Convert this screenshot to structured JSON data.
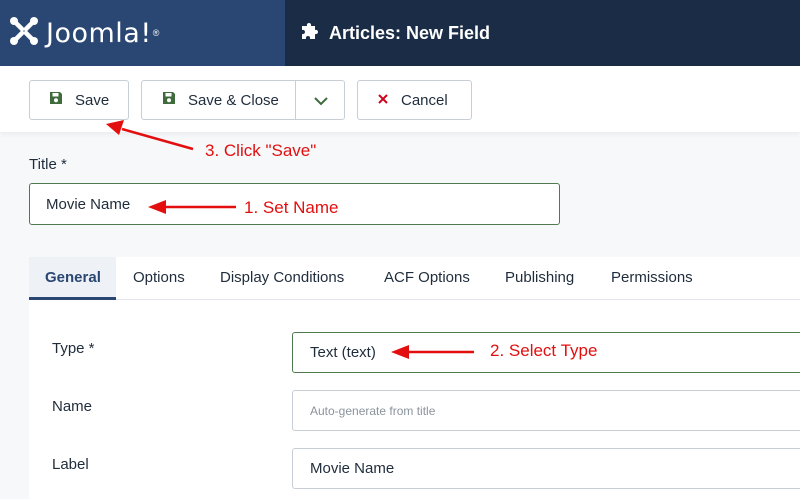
{
  "header": {
    "brand": "Joomla!",
    "page_title": "Articles: New Field"
  },
  "toolbar": {
    "save_label": "Save",
    "save_close_label": "Save & Close",
    "cancel_label": "Cancel"
  },
  "form": {
    "title_label": "Title *",
    "title_value": "Movie Name"
  },
  "tabs": [
    "General",
    "Options",
    "Display Conditions",
    "ACF Options",
    "Publishing",
    "Permissions"
  ],
  "fields": {
    "type_label": "Type *",
    "type_value": "Text (text)",
    "name_label": "Name",
    "name_placeholder": "Auto-generate from title",
    "label_label": "Label",
    "label_value": "Movie Name"
  },
  "annotations": {
    "step1": "1. Set Name",
    "step2": "2. Select Type",
    "step3": "3. Click \"Save\""
  },
  "colors": {
    "header_bg": "#1b2d46",
    "brand_bg": "#2a4773",
    "valid_border": "#4f7a4e",
    "annotation_red": "#e30f0f",
    "cancel_x": "#d0021b",
    "save_icon": "#3f6b3d"
  }
}
